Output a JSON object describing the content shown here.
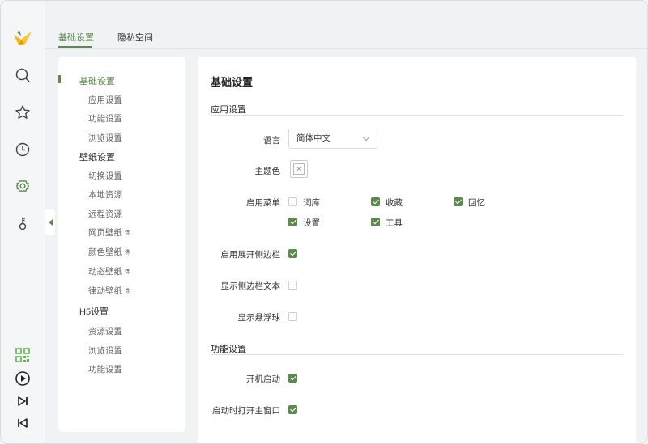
{
  "colors": {
    "accent": "#5b8a4e",
    "logo": "#f5b915"
  },
  "tabs": [
    {
      "label": "基础设置",
      "active": true
    },
    {
      "label": "隐私空间",
      "active": false
    }
  ],
  "sidebar": {
    "icons": [
      "logo-icon",
      "search-icon",
      "star-icon",
      "clock-icon",
      "gear-icon",
      "key-icon",
      "qrcode-icon",
      "play-icon",
      "skip-next-icon",
      "skip-prev-icon"
    ]
  },
  "menu": {
    "groups": [
      {
        "label": "基础设置",
        "items": [
          "应用设置",
          "功能设置",
          "浏览设置"
        ]
      },
      {
        "label": "壁纸设置",
        "items": [
          "切换设置",
          "本地资源",
          "远程资源",
          "网页壁纸",
          "颜色壁纸",
          "动态壁纸",
          "律动壁纸"
        ]
      },
      {
        "label": "H5设置",
        "items": [
          "资源设置",
          "浏览设置",
          "功能设置"
        ]
      }
    ]
  },
  "content": {
    "title": "基础设置",
    "app_section": {
      "title": "应用设置",
      "language_label": "语言",
      "language_value": "简体中文",
      "theme_label": "主题色",
      "menu_label": "启用菜单",
      "menu_options": [
        {
          "label": "词库",
          "checked": false
        },
        {
          "label": "收藏",
          "checked": true
        },
        {
          "label": "回忆",
          "checked": true
        },
        {
          "label": "设置",
          "checked": true
        },
        {
          "label": "工具",
          "checked": true
        }
      ],
      "expand_sidebar_label": "启用展开侧边栏",
      "expand_sidebar": true,
      "show_sidebar_text_label": "显示侧边栏文本",
      "show_sidebar_text": false,
      "show_float_label": "显示悬浮球",
      "show_float": false
    },
    "func_section": {
      "title": "功能设置",
      "autostart_label": "开机启动",
      "autostart": true,
      "open_main_label": "启动时打开主窗口",
      "open_main": true
    }
  }
}
